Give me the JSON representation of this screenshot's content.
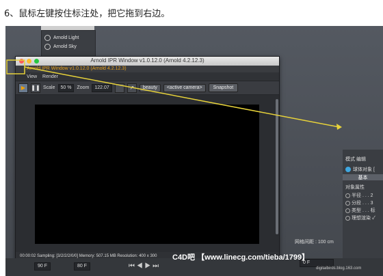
{
  "caption": "6、鼠标左键按住标注处，把它拖到右边。",
  "object_menu": {
    "items": [
      "Arnold Light",
      "Arnold Sky"
    ]
  },
  "ipr_window": {
    "title": "Arnold IPR Window v1.0.12.0 (Arnold 4.2.12.3)",
    "subtitle": "Arnold IPR Window v1.0.12.0 (Arnold 4.2.12.3)",
    "menus": [
      "View",
      "Render"
    ],
    "toolbar": {
      "scale_label": "Scale",
      "scale_value": "50 %",
      "zoom_label": "Zoom",
      "zoom_value": "122.07",
      "aov_dropdown": "beauty",
      "camera_dropdown": "<active camera>",
      "snapshot_label": "Snapshot"
    },
    "status": "00:00:02  Sampling: [3/2/2/2/0/0]  Memory: 507.15 MB  Resolution: 400 x 300"
  },
  "viewport": {
    "grid_spacing": "网格间距 : 100 cm"
  },
  "right_panel": {
    "tabs_row": "模式  编辑",
    "object_label": "球体对象 [",
    "basic_tab": "基本",
    "section_title": "对象属性",
    "rows": [
      "半径 . . . 2",
      "分段 . . . 3",
      "类型 . . . 标",
      "理想渲染 ✓"
    ]
  },
  "timeline": {
    "field_left": "90 F",
    "field_mid": "80 F",
    "field_right": "0 F"
  },
  "watermark": {
    "brand": "C4D吧",
    "text": "【www.linecg.com/tieba/1799】"
  },
  "credit": "digitalbirds.blog.163.com",
  "colors": {
    "accent_orange": "#e9a21c",
    "arrow_yellow": "#e8d33a"
  }
}
